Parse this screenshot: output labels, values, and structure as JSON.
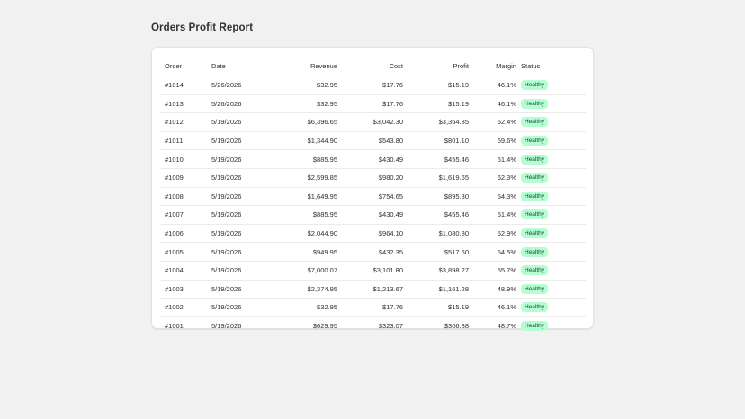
{
  "page": {
    "title": "Orders Profit Report"
  },
  "table": {
    "headers": {
      "order": "Order",
      "date": "Date",
      "revenue": "Revenue",
      "cost": "Cost",
      "profit": "Profit",
      "margin": "Margin",
      "status": "Status"
    },
    "rows": [
      {
        "order": "#1014",
        "date": "5/26/2026",
        "revenue": "$32.95",
        "cost": "$17.76",
        "profit": "$15.19",
        "margin": "46.1%",
        "status": "Healthy"
      },
      {
        "order": "#1013",
        "date": "5/26/2026",
        "revenue": "$32.95",
        "cost": "$17.76",
        "profit": "$15.19",
        "margin": "46.1%",
        "status": "Healthy"
      },
      {
        "order": "#1012",
        "date": "5/19/2026",
        "revenue": "$6,396.65",
        "cost": "$3,042.30",
        "profit": "$3,354.35",
        "margin": "52.4%",
        "status": "Healthy"
      },
      {
        "order": "#1011",
        "date": "5/19/2026",
        "revenue": "$1,344.90",
        "cost": "$543.80",
        "profit": "$801.10",
        "margin": "59.6%",
        "status": "Healthy"
      },
      {
        "order": "#1010",
        "date": "5/19/2026",
        "revenue": "$885.95",
        "cost": "$430.49",
        "profit": "$455.46",
        "margin": "51.4%",
        "status": "Healthy"
      },
      {
        "order": "#1009",
        "date": "5/19/2026",
        "revenue": "$2,599.85",
        "cost": "$980.20",
        "profit": "$1,619.65",
        "margin": "62.3%",
        "status": "Healthy"
      },
      {
        "order": "#1008",
        "date": "5/19/2026",
        "revenue": "$1,649.95",
        "cost": "$754.65",
        "profit": "$895.30",
        "margin": "54.3%",
        "status": "Healthy"
      },
      {
        "order": "#1007",
        "date": "5/19/2026",
        "revenue": "$885.95",
        "cost": "$430.49",
        "profit": "$455.46",
        "margin": "51.4%",
        "status": "Healthy"
      },
      {
        "order": "#1006",
        "date": "5/19/2026",
        "revenue": "$2,044.90",
        "cost": "$964.10",
        "profit": "$1,080.80",
        "margin": "52.9%",
        "status": "Healthy"
      },
      {
        "order": "#1005",
        "date": "5/19/2026",
        "revenue": "$949.95",
        "cost": "$432.35",
        "profit": "$517.60",
        "margin": "54.5%",
        "status": "Healthy"
      },
      {
        "order": "#1004",
        "date": "5/19/2026",
        "revenue": "$7,000.07",
        "cost": "$3,101.80",
        "profit": "$3,898.27",
        "margin": "55.7%",
        "status": "Healthy"
      },
      {
        "order": "#1003",
        "date": "5/19/2026",
        "revenue": "$2,374.95",
        "cost": "$1,213.67",
        "profit": "$1,161.28",
        "margin": "48.9%",
        "status": "Healthy"
      },
      {
        "order": "#1002",
        "date": "5/19/2026",
        "revenue": "$32.95",
        "cost": "$17.76",
        "profit": "$15.19",
        "margin": "46.1%",
        "status": "Healthy"
      },
      {
        "order": "#1001",
        "date": "5/19/2026",
        "revenue": "$629.95",
        "cost": "$323.07",
        "profit": "$306.88",
        "margin": "48.7%",
        "status": "Healthy"
      }
    ]
  },
  "colors": {
    "badge_background": "#b4fed2",
    "badge_text": "#0c5132"
  }
}
